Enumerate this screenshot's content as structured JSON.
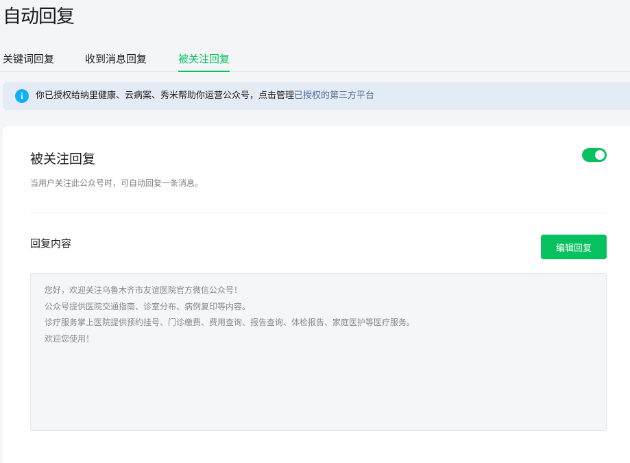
{
  "page": {
    "title": "自动回复"
  },
  "tabs": [
    {
      "label": "关键词回复",
      "active": false
    },
    {
      "label": "收到消息回复",
      "active": false
    },
    {
      "label": "被关注回复",
      "active": true
    }
  ],
  "notice": {
    "icon": "info-icon",
    "text": "你已授权给纳里健康、云病案、秀米帮助你运营公众号，点击管理",
    "link": "已授权的第三方平台"
  },
  "follow_reply": {
    "title": "被关注回复",
    "description": "当用户关注此公众号时，可自动回复一条消息。",
    "toggle_on": true
  },
  "reply_content": {
    "label": "回复内容",
    "edit_button": "编辑回复",
    "lines": [
      "您好，欢迎关注乌鲁木齐市友谊医院官方微信公众号！",
      "公众号提供医院交通指南、诊室分布、病例复印等内容。",
      "诊疗服务掌上医院提供预约挂号、门诊缴费、费用查询、报告查询、体检报告、家庭医护等医疗服务。",
      "欢迎您使用！"
    ]
  },
  "colors": {
    "accent": "#07c160",
    "info": "#10aeff",
    "link": "#576b95",
    "notice_bg": "#e3ebf5"
  }
}
